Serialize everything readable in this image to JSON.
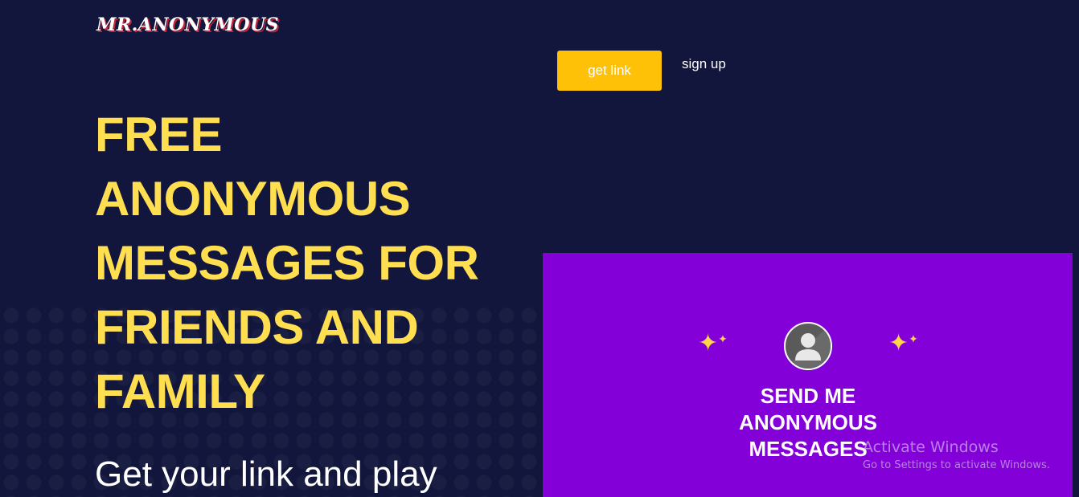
{
  "header": {
    "logo_text": "MR.ANONYMOUS",
    "get_link_label": "get link",
    "sign_up_label": "sign up"
  },
  "hero": {
    "headline": "FREE ANONYMOUS MESSAGES FOR FRIENDS AND FAMILY",
    "subline": "Get your link and play"
  },
  "promo_card": {
    "title": "SEND ME ANONYMOUS MESSAGES",
    "left_icon": "sparkles-icon",
    "right_icon": "sparkles-icon",
    "avatar_icon": "user-avatar-icon"
  },
  "watermark": {
    "title": "Activate Windows",
    "subtitle": "Go to Settings to activate Windows."
  },
  "colors": {
    "background": "#13163c",
    "headline": "#ffdf4f",
    "button": "#ffc107",
    "card": "#8300d8"
  }
}
